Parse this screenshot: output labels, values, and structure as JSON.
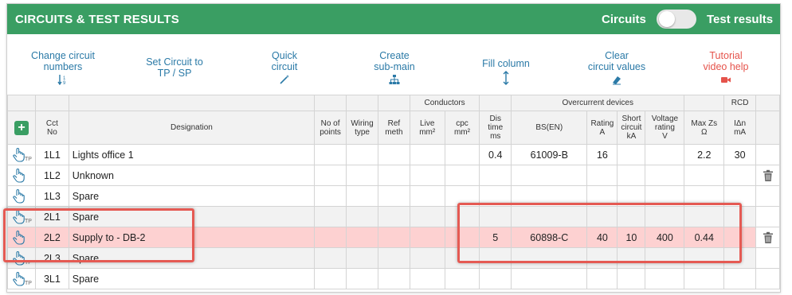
{
  "header": {
    "title": "CIRCUITS & TEST RESULTS",
    "toggle_left": "Circuits",
    "toggle_right": "Test results"
  },
  "toolbar": {
    "change_numbers_l1": "Change circuit",
    "change_numbers_l2": "numbers",
    "set_tp_l1": "Set Circuit to",
    "set_tp_l2": "TP / SP",
    "quick_l1": "Quick",
    "quick_l2": "circuit",
    "sub_main_l1": "Create",
    "sub_main_l2": "sub-main",
    "fill_column": "Fill column",
    "clear_l1": "Clear",
    "clear_l2": "circuit values",
    "tutorial_l1": "Tutorial",
    "tutorial_l2": "video help"
  },
  "table": {
    "group_headers": {
      "conductors": "Conductors",
      "overcurrent": "Overcurrent devices",
      "rcd": "RCD"
    },
    "columns": {
      "cct_no": [
        "Cct",
        "No"
      ],
      "designation": "Designation",
      "no_points": [
        "No of",
        "points"
      ],
      "wiring_type": [
        "Wiring",
        "type"
      ],
      "ref_meth": [
        "Ref",
        "meth"
      ],
      "live": [
        "Live",
        "mm²"
      ],
      "cpc": [
        "cpc",
        "mm²"
      ],
      "dis_time": [
        "Dis",
        "time",
        "ms"
      ],
      "bs_en": "BS(EN)",
      "rating": [
        "Rating",
        "A"
      ],
      "short_circuit": [
        "Short",
        "circuit",
        "kA"
      ],
      "voltage_rating": [
        "Voltage",
        "rating",
        "V"
      ],
      "max_zs": [
        "Max Zs",
        "Ω"
      ],
      "idn": [
        "IΔn",
        "mA"
      ]
    },
    "rows": [
      {
        "cct": "1L1",
        "designation": "Lights office 1",
        "dis": "0.4",
        "bs": "61009-B",
        "rating": "16",
        "short": "",
        "volt": "",
        "maxzs": "2.2",
        "idn": "30"
      },
      {
        "cct": "1L2",
        "designation": "Unknown",
        "dis": "",
        "bs": "",
        "rating": "",
        "short": "",
        "volt": "",
        "maxzs": "",
        "idn": ""
      },
      {
        "cct": "1L3",
        "designation": "Spare",
        "dis": "",
        "bs": "",
        "rating": "",
        "short": "",
        "volt": "",
        "maxzs": "",
        "idn": ""
      },
      {
        "cct": "2L1",
        "designation": "Spare",
        "dis": "",
        "bs": "",
        "rating": "",
        "short": "",
        "volt": "",
        "maxzs": "",
        "idn": ""
      },
      {
        "cct": "2L2",
        "designation": "Supply to - DB-2",
        "dis": "5",
        "bs": "60898-C",
        "rating": "40",
        "short": "10",
        "volt": "400",
        "maxzs": "0.44",
        "idn": ""
      },
      {
        "cct": "2L3",
        "designation": "Spare",
        "dis": "",
        "bs": "",
        "rating": "",
        "short": "",
        "volt": "",
        "maxzs": "",
        "idn": ""
      },
      {
        "cct": "3L1",
        "designation": "Spare",
        "dis": "",
        "bs": "",
        "rating": "",
        "short": "",
        "volt": "",
        "maxzs": "",
        "idn": ""
      }
    ]
  },
  "colors": {
    "header_green": "#3a9e63",
    "link_blue": "#2b7aa7",
    "tutorial_red": "#e5534b",
    "highlight_pink": "#fdd1d1",
    "annotation_red": "#e55a53"
  }
}
